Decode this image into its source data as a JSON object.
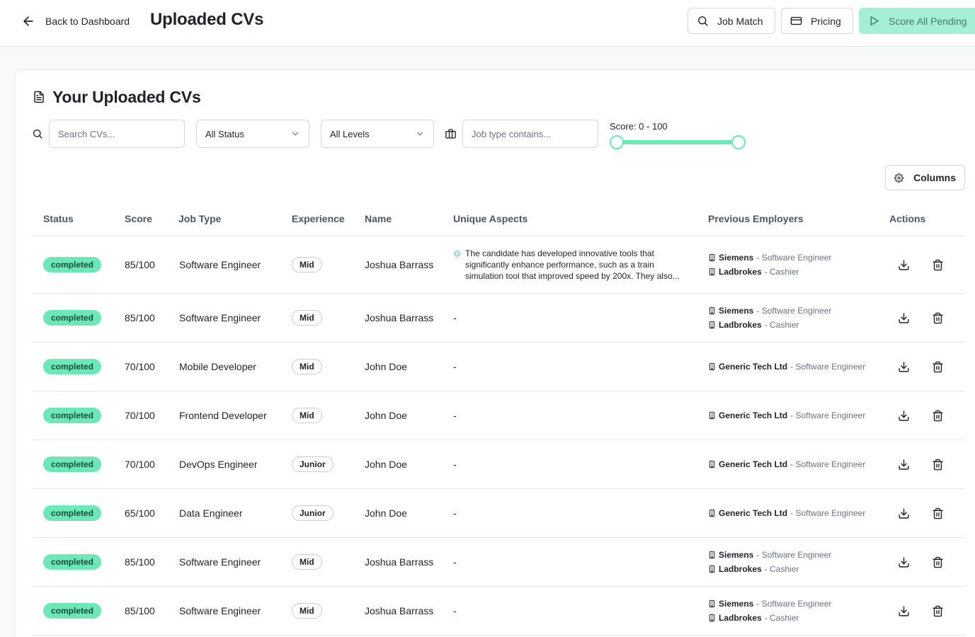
{
  "header": {
    "back_label": "Back to Dashboard",
    "title": "Uploaded CVs",
    "job_match_label": "Job Match",
    "pricing_label": "Pricing",
    "score_pending_label": "Score All Pending"
  },
  "card": {
    "title": "Your Uploaded CVs"
  },
  "filters": {
    "search_placeholder": "Search CVs...",
    "status_value": "All Status",
    "levels_value": "All Levels",
    "jobtype_placeholder": "Job type contains...",
    "score_label": "Score: 0 - 100",
    "score_min": 0,
    "score_max": 100
  },
  "columns_label": "Columns",
  "table": {
    "headers": {
      "status": "Status",
      "score": "Score",
      "job_type": "Job Type",
      "experience": "Experience",
      "name": "Name",
      "unique": "Unique Aspects",
      "employers": "Previous Employers",
      "actions": "Actions"
    },
    "rows": [
      {
        "status": "completed",
        "score": "85/100",
        "job_type": "Software Engineer",
        "experience": "Mid",
        "name": "Joshua Barrass",
        "unique": "The candidate has developed innovative tools that significantly enhance performance, such as a train simulation tool that improved speed by 200x. They also...",
        "employers": [
          {
            "name": "Siemens",
            "role": " - Software Engineer"
          },
          {
            "name": "Ladbrokes",
            "role": " - Cashier"
          }
        ]
      },
      {
        "status": "completed",
        "score": "85/100",
        "job_type": "Software Engineer",
        "experience": "Mid",
        "name": "Joshua Barrass",
        "unique": "-",
        "employers": [
          {
            "name": "Siemens",
            "role": " - Software Engineer"
          },
          {
            "name": "Ladbrokes",
            "role": " - Cashier"
          }
        ]
      },
      {
        "status": "completed",
        "score": "70/100",
        "job_type": "Mobile Developer",
        "experience": "Mid",
        "name": "John Doe",
        "unique": "-",
        "employers": [
          {
            "name": "Generic Tech Ltd",
            "role": " - Software Engineer"
          }
        ]
      },
      {
        "status": "completed",
        "score": "70/100",
        "job_type": "Frontend Developer",
        "experience": "Mid",
        "name": "John Doe",
        "unique": "-",
        "employers": [
          {
            "name": "Generic Tech Ltd",
            "role": " - Software Engineer"
          }
        ]
      },
      {
        "status": "completed",
        "score": "70/100",
        "job_type": "DevOps Engineer",
        "experience": "Junior",
        "name": "John Doe",
        "unique": "-",
        "employers": [
          {
            "name": "Generic Tech Ltd",
            "role": " - Software Engineer"
          }
        ]
      },
      {
        "status": "completed",
        "score": "65/100",
        "job_type": "Data Engineer",
        "experience": "Junior",
        "name": "John Doe",
        "unique": "-",
        "employers": [
          {
            "name": "Generic Tech Ltd",
            "role": " - Software Engineer"
          }
        ]
      },
      {
        "status": "completed",
        "score": "85/100",
        "job_type": "Software Engineer",
        "experience": "Mid",
        "name": "Joshua Barrass",
        "unique": "-",
        "employers": [
          {
            "name": "Siemens",
            "role": " - Software Engineer"
          },
          {
            "name": "Ladbrokes",
            "role": " - Cashier"
          }
        ]
      },
      {
        "status": "completed",
        "score": "85/100",
        "job_type": "Software Engineer",
        "experience": "Mid",
        "name": "Joshua Barrass",
        "unique": "-",
        "employers": [
          {
            "name": "Siemens",
            "role": " - Software Engineer"
          },
          {
            "name": "Ladbrokes",
            "role": " - Cashier"
          }
        ]
      }
    ]
  },
  "colors": {
    "accent": "#6ee7b7",
    "accent_light": "#a5efd4",
    "border": "#e4e6ea"
  },
  "icons": {
    "back": "arrow-left-icon",
    "job_match": "search-icon",
    "pricing": "credit-card-icon",
    "score_pending": "play-icon",
    "card_title": "file-text-icon",
    "filter_search": "search-icon",
    "filter_jobtype": "briefcase-icon",
    "columns": "gear-icon",
    "aspect": "sparkle-icon",
    "employer": "building-icon",
    "download": "download-icon",
    "delete": "trash-icon"
  }
}
